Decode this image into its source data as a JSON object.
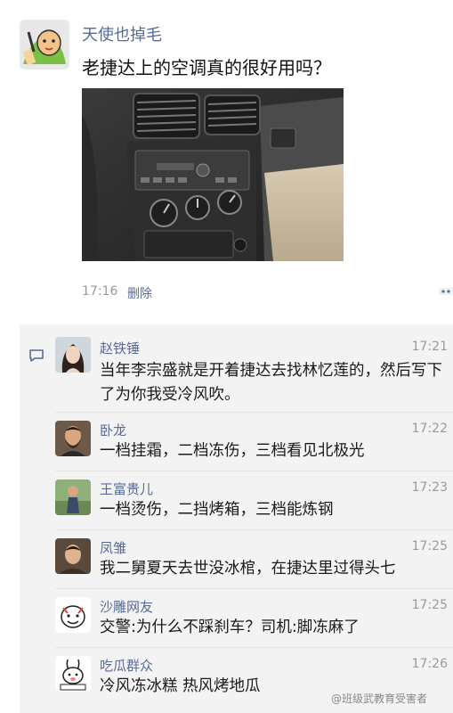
{
  "post": {
    "author": "天使也掉毛",
    "text": "老捷达上的空调真的很好用吗？",
    "time": "17:16",
    "delete_label": "删除",
    "avatar_icon": "cartoon-character-avatar",
    "photo_icon": "car-dashboard-photo"
  },
  "comments": [
    {
      "name": "赵铁锤",
      "time": "17:21",
      "text": "当年李宗盛就是开着捷达去找林忆莲的，然后写下了为你我受冷风吹。",
      "avatar_icon": "woman-avatar"
    },
    {
      "name": "卧龙",
      "time": "17:22",
      "text": "一档挂霜，二档冻伤，三档看见北极光",
      "avatar_icon": "bearded-man-avatar"
    },
    {
      "name": "王富贵儿",
      "time": "17:23",
      "text": "一档烫伤，二挡烤箱，三档能炼钢",
      "avatar_icon": "person-outdoors-avatar"
    },
    {
      "name": "凤雏",
      "time": "17:25",
      "text": "我二舅夏天去世没冰棺，在捷达里过得头七",
      "avatar_icon": "man-portrait-avatar"
    },
    {
      "name": "沙雕网友",
      "time": "17:25",
      "text": "交警:为什么不踩刹车？司机:脚冻麻了",
      "avatar_icon": "cartoon-face-avatar"
    },
    {
      "name": "吃瓜群众",
      "time": "17:26",
      "text": "冷风冻冰糕 热风烤地瓜",
      "avatar_icon": "cartoon-bunny-avatar"
    }
  ],
  "watermark": "@班级武教育受害者",
  "colors": {
    "name_link": "#576b95",
    "comment_bg": "#f3f3f3",
    "time_gray": "#999999"
  }
}
